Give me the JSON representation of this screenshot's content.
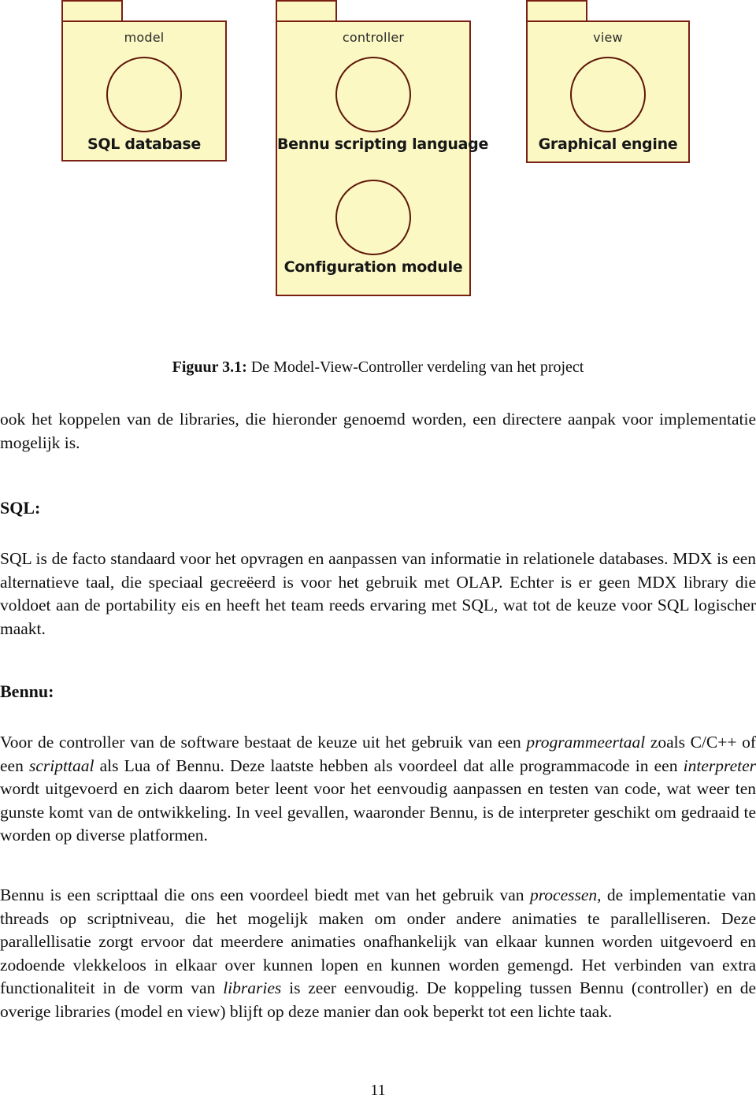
{
  "figure": {
    "packages": [
      {
        "name": "model",
        "components": [
          {
            "label": "SQL database",
            "icon": "circle-component-icon"
          }
        ]
      },
      {
        "name": "controller",
        "components": [
          {
            "label": "Bennu scripting language",
            "icon": "circle-component-icon"
          },
          {
            "label": "Configuration module",
            "icon": "circle-component-icon"
          }
        ]
      },
      {
        "name": "view",
        "components": [
          {
            "label": "Graphical engine",
            "icon": "circle-component-icon"
          }
        ]
      }
    ],
    "colors": {
      "package_fill": "#fbf8c4",
      "package_border": "#7a1f12",
      "component_border": "#5e1708"
    }
  },
  "caption": {
    "label": "Figuur 3.1:",
    "text": "De Model-View-Controller verdeling van het project"
  },
  "body": {
    "intro": "ook het koppelen van de libraries, die hieronder genoemd worden, een directere aanpak voor implementatie mogelijk is.",
    "sql_heading": "SQL:",
    "sql_paragraph": "SQL is de facto standaard voor het opvragen en aanpassen van informatie in relationele databases. MDX is een alternatieve taal, die speciaal gecreëerd is voor het gebruik met OLAP. Echter is er geen MDX library die voldoet aan de portability eis en heeft het team reeds ervaring met SQL, wat tot de keuze voor SQL logischer maakt.",
    "bennu_heading": "Bennu:",
    "bennu_paragraph_1": {
      "t1": "Voor de controller van de software bestaat de keuze uit het gebruik van een ",
      "i1": "programmeertaal",
      "t2": " zoals C/C++ of een ",
      "i2": "scripttaal",
      "t3": " als Lua of Bennu. Deze laatste hebben als voordeel dat alle programmacode in een ",
      "i3": "interpreter",
      "t4": " wordt uitgevoerd en zich daarom beter leent voor het eenvoudig aanpassen en testen van code, wat weer ten gunste komt van de ontwikkeling. In veel gevallen, waaronder Bennu, is de interpreter geschikt om gedraaid te worden op diverse platformen."
    },
    "bennu_paragraph_2": {
      "t1": "Bennu is een scripttaal die ons een voordeel biedt met van het gebruik van ",
      "i1": "processen",
      "t2": ", de implementatie van threads op scriptniveau, die het mogelijk maken om onder andere animaties te parallelliseren. Deze parallellisatie zorgt ervoor dat meerdere animaties onafhankelijk van elkaar kunnen worden uitgevoerd en zodoende vlekkeloos in elkaar over kunnen lopen en kunnen worden gemengd. Het verbinden van extra functionaliteit in de vorm van ",
      "i2": "libraries",
      "t3": " is zeer eenvoudig. De koppeling tussen Bennu (controller) en de overige libraries (model en view) blijft op deze manier dan ook beperkt tot een lichte taak."
    }
  },
  "footer": {
    "page_number": "11"
  }
}
